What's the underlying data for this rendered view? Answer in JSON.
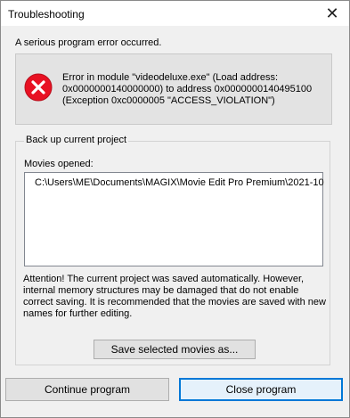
{
  "window": {
    "title": "Troubleshooting",
    "close_glyph": "✕"
  },
  "message": "A serious program error occurred.",
  "error": {
    "icon": "error-icon",
    "icon_color": "#e81123",
    "text": "Error in module \"videodeluxe.exe\" (Load address:\n0x0000000140000000) to address 0x0000000140495100\n(Exception 0xc0000005 \"ACCESS_VIOLATION\")"
  },
  "backup": {
    "group_label": "Back up current project",
    "movies_label": "Movies opened:",
    "movies": [
      "C:\\Users\\ME\\Documents\\MAGIX\\Movie Edit Pro Premium\\2021-10"
    ],
    "attention_text": "Attention! The current project was saved automatically. However, internal memory structures may be damaged that do not enable correct saving.\nIt is recommended that the movies are saved with new names for further editing.",
    "save_button": "Save selected movies as..."
  },
  "buttons": {
    "continue": "Continue program",
    "close": "Close program"
  },
  "colors": {
    "focus_border": "#0078d7"
  }
}
